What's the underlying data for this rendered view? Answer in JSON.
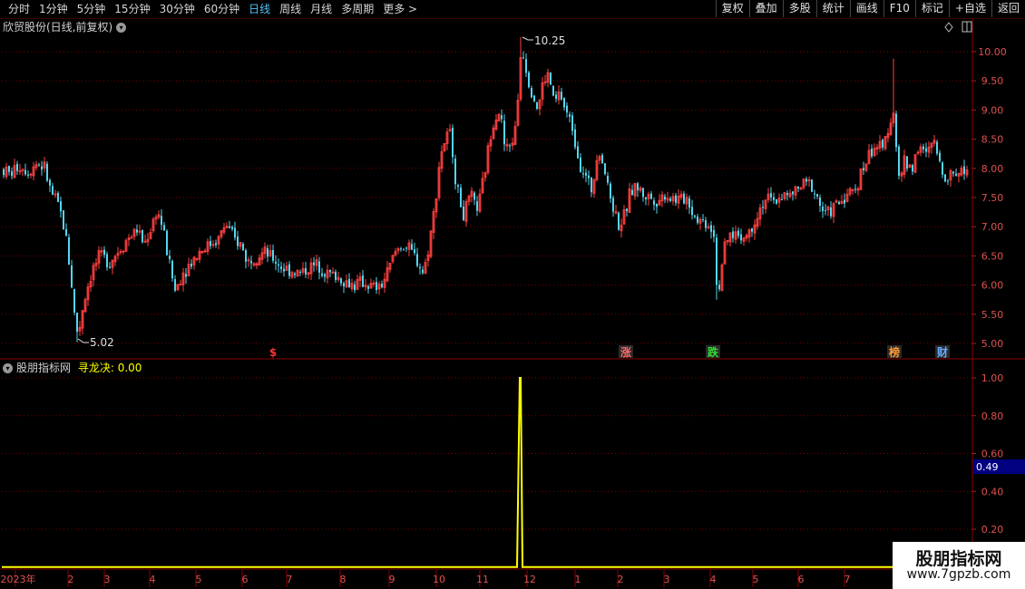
{
  "toolbar": {
    "periods": [
      "分时",
      "1分钟",
      "5分钟",
      "15分钟",
      "30分钟",
      "60分钟",
      "日线",
      "周线",
      "月线",
      "多周期",
      "更多 >"
    ],
    "active_period": "日线",
    "right_buttons": [
      "复权",
      "叠加",
      "多股",
      "统计",
      "画线",
      "F10",
      "标记",
      "+自选",
      "返回"
    ]
  },
  "main_chart": {
    "title": "欣贸股份(日线,前复权)",
    "icons": [
      "diamond-icon",
      "panel-toggle-icon"
    ],
    "y_ticks": [
      "10.00",
      "9.50",
      "9.00",
      "8.50",
      "8.00",
      "7.50",
      "7.00",
      "6.50",
      "6.00",
      "5.50",
      "5.00"
    ],
    "high_label": "10.25",
    "low_label": "5.02",
    "markers": [
      {
        "text": "$",
        "color": "#ff3333"
      },
      {
        "text": "涨",
        "color": "#ff6666"
      },
      {
        "text": "跌",
        "color": "#33dd33"
      },
      {
        "text": "榜",
        "color": "#ff9933"
      },
      {
        "text": "财",
        "color": "#66aaff"
      }
    ]
  },
  "indicator": {
    "title": "股朋指标网",
    "indicator_label": "寻龙决: 0.00",
    "y_ticks": [
      "1.00",
      "0.80",
      "0.60",
      "0.40",
      "0.20"
    ],
    "cursor_value": "0.49"
  },
  "x_axis": {
    "labels": [
      "2023年",
      "2",
      "3",
      "4",
      "5",
      "6",
      "7",
      "8",
      "9",
      "10",
      "11",
      "12",
      "1",
      "2",
      "3",
      "4",
      "5",
      "6",
      "7"
    ]
  },
  "watermark": {
    "line1": "股朋指标网",
    "line2": "www.7gpzb.com"
  },
  "colors": {
    "up": "#ff4040",
    "down": "#54d6f0",
    "grid": "#7a0000",
    "indicator_line": "#ffff00",
    "cursor_box": "#000080"
  },
  "chart_data": [
    {
      "type": "candlestick",
      "title": "欣贸股份(日线,前复权)",
      "ylim": [
        4.85,
        10.35
      ],
      "price_path": [
        [
          0,
          8.0
        ],
        [
          10,
          7.9
        ],
        [
          20,
          8.05
        ],
        [
          30,
          7.95
        ],
        [
          40,
          8.1
        ],
        [
          48,
          8.0
        ],
        [
          55,
          7.6
        ],
        [
          65,
          7.3
        ],
        [
          72,
          6.8
        ],
        [
          78,
          6.0
        ],
        [
          84,
          5.02
        ],
        [
          90,
          5.6
        ],
        [
          96,
          6.0
        ],
        [
          102,
          6.3
        ],
        [
          110,
          6.5
        ],
        [
          120,
          6.4
        ],
        [
          130,
          6.6
        ],
        [
          140,
          6.8
        ],
        [
          150,
          6.95
        ],
        [
          158,
          6.7
        ],
        [
          166,
          7.0
        ],
        [
          172,
          7.3
        ],
        [
          178,
          7.0
        ],
        [
          184,
          6.5
        ],
        [
          192,
          5.9
        ],
        [
          200,
          6.2
        ],
        [
          210,
          6.4
        ],
        [
          220,
          6.6
        ],
        [
          230,
          6.7
        ],
        [
          240,
          6.8
        ],
        [
          248,
          7.05
        ],
        [
          256,
          6.8
        ],
        [
          264,
          6.7
        ],
        [
          272,
          6.4
        ],
        [
          280,
          6.5
        ],
        [
          290,
          6.55
        ],
        [
          300,
          6.45
        ],
        [
          310,
          6.3
        ],
        [
          320,
          6.25
        ],
        [
          330,
          6.2
        ],
        [
          340,
          6.3
        ],
        [
          350,
          6.35
        ],
        [
          360,
          6.2
        ],
        [
          370,
          6.15
        ],
        [
          380,
          6.05
        ],
        [
          390,
          6.0
        ],
        [
          400,
          6.05
        ],
        [
          410,
          5.95
        ],
        [
          418,
          5.95
        ],
        [
          426,
          6.2
        ],
        [
          434,
          6.55
        ],
        [
          442,
          6.7
        ],
        [
          450,
          6.6
        ],
        [
          458,
          6.45
        ],
        [
          466,
          6.2
        ],
        [
          472,
          6.7
        ],
        [
          478,
          7.3
        ],
        [
          484,
          8.2
        ],
        [
          490,
          8.5
        ],
        [
          496,
          8.6
        ],
        [
          502,
          7.7
        ],
        [
          510,
          7.2
        ],
        [
          518,
          7.5
        ],
        [
          526,
          7.3
        ],
        [
          532,
          7.8
        ],
        [
          538,
          8.4
        ],
        [
          544,
          8.9
        ],
        [
          550,
          9.0
        ],
        [
          556,
          8.3
        ],
        [
          562,
          8.4
        ],
        [
          568,
          8.7
        ],
        [
          574,
          10.25
        ],
        [
          580,
          9.6
        ],
        [
          586,
          9.3
        ],
        [
          592,
          9.0
        ],
        [
          598,
          9.5
        ],
        [
          604,
          9.6
        ],
        [
          610,
          9.1
        ],
        [
          616,
          9.3
        ],
        [
          622,
          9.0
        ],
        [
          630,
          8.7
        ],
        [
          638,
          8.1
        ],
        [
          646,
          7.8
        ],
        [
          652,
          7.6
        ],
        [
          658,
          8.4
        ],
        [
          664,
          8.1
        ],
        [
          670,
          7.6
        ],
        [
          676,
          7.3
        ],
        [
          682,
          7.0
        ],
        [
          688,
          7.2
        ],
        [
          694,
          7.6
        ],
        [
          700,
          7.7
        ],
        [
          708,
          7.55
        ],
        [
          716,
          7.5
        ],
        [
          724,
          7.45
        ],
        [
          732,
          7.55
        ],
        [
          740,
          7.5
        ],
        [
          748,
          7.45
        ],
        [
          756,
          7.5
        ],
        [
          764,
          7.2
        ],
        [
          772,
          7.1
        ],
        [
          780,
          7.05
        ],
        [
          786,
          6.9
        ],
        [
          790,
          5.75
        ],
        [
          796,
          6.5
        ],
        [
          802,
          6.8
        ],
        [
          808,
          6.9
        ],
        [
          814,
          6.85
        ],
        [
          820,
          6.8
        ],
        [
          828,
          7.0
        ],
        [
          836,
          7.3
        ],
        [
          844,
          7.5
        ],
        [
          852,
          7.4
        ],
        [
          860,
          7.55
        ],
        [
          868,
          7.5
        ],
        [
          876,
          7.6
        ],
        [
          884,
          7.7
        ],
        [
          892,
          7.75
        ],
        [
          900,
          7.5
        ],
        [
          908,
          7.2
        ],
        [
          916,
          7.3
        ],
        [
          924,
          7.4
        ],
        [
          932,
          7.55
        ],
        [
          940,
          7.6
        ],
        [
          948,
          7.9
        ],
        [
          956,
          8.2
        ],
        [
          964,
          8.4
        ],
        [
          972,
          8.3
        ],
        [
          978,
          8.7
        ],
        [
          984,
          9.0
        ],
        [
          990,
          7.8
        ],
        [
          996,
          8.1
        ],
        [
          1004,
          8.0
        ],
        [
          1012,
          8.4
        ],
        [
          1020,
          8.2
        ],
        [
          1028,
          8.5
        ],
        [
          1036,
          8.0
        ],
        [
          1044,
          7.85
        ],
        [
          1052,
          7.95
        ],
        [
          1060,
          7.95
        ],
        [
          1066,
          8.0
        ]
      ],
      "high": 10.25,
      "low": 5.02
    },
    {
      "type": "line",
      "title": "寻龙决",
      "ylim": [
        0.12,
        1.05
      ],
      "x": [
        "2023-01-03",
        "2023-11-27",
        "2023-11-28",
        "2023-11-29",
        "2023-11-30",
        "2024-07-31"
      ],
      "spike": {
        "position": 573,
        "value": 1.0
      }
    }
  ]
}
